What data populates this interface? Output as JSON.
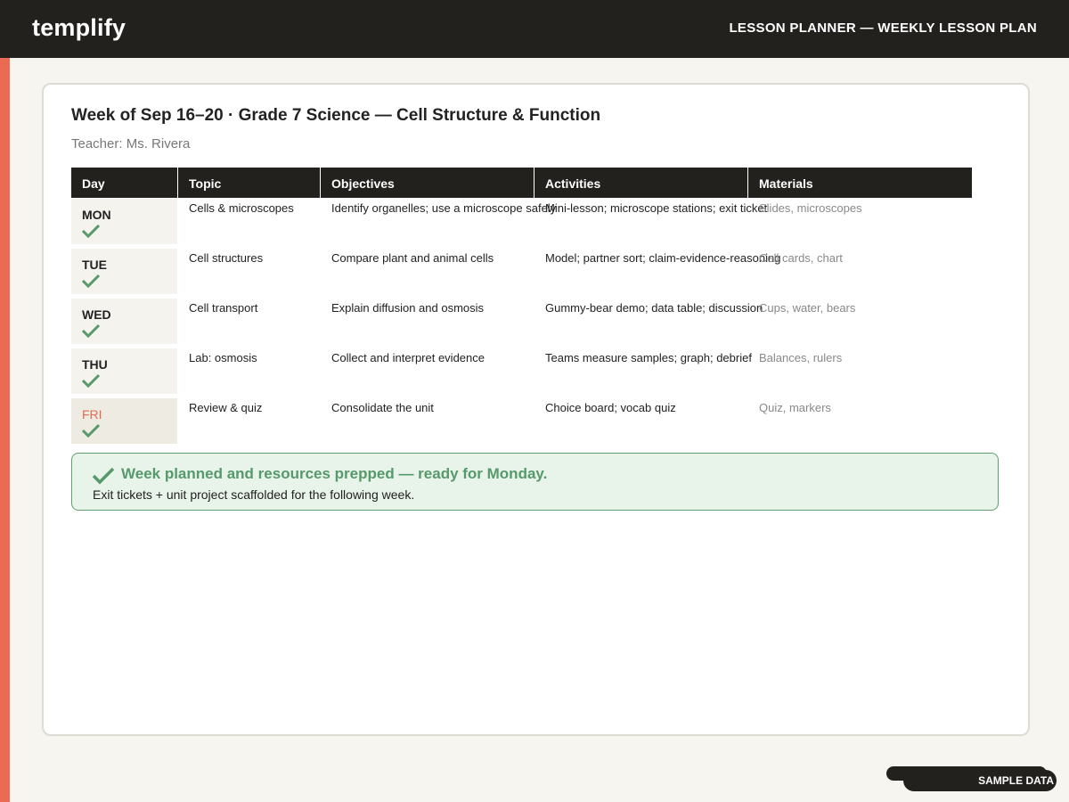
{
  "app": {
    "brand": "templify",
    "section_title": "LESSON PLANNER — WEEKLY LESSON PLAN"
  },
  "plan": {
    "title": "Week of Sep 16–20 · Grade 7 Science — Cell Structure & Function",
    "teacher": "Teacher: Ms. Rivera"
  },
  "table": {
    "headers": [
      "Day",
      "Topic",
      "Objectives",
      "Activities",
      "Materials"
    ],
    "rows": [
      {
        "day": "MON",
        "topic": "Cells & microscopes",
        "objectives": "Identify organelles; use a microscope safely",
        "activities": "Mini-lesson; microscope stations; exit ticket",
        "materials": "Slides, microscopes",
        "done": true,
        "current": false
      },
      {
        "day": "TUE",
        "topic": "Cell structures",
        "objectives": "Compare plant and animal cells",
        "activities": "Model; partner sort; claim-evidence-reasoning",
        "materials": "Cell cards, chart",
        "done": true,
        "current": false
      },
      {
        "day": "WED",
        "topic": "Cell transport",
        "objectives": "Explain diffusion and osmosis",
        "activities": "Gummy-bear demo; data table; discussion",
        "materials": "Cups, water, bears",
        "done": true,
        "current": false
      },
      {
        "day": "THU",
        "topic": "Lab: osmosis",
        "objectives": "Collect and interpret evidence",
        "activities": "Teams measure samples; graph; debrief",
        "materials": "Balances, rulers",
        "done": true,
        "current": false
      },
      {
        "day": "FRI",
        "topic": "Review & quiz",
        "objectives": "Consolidate the unit",
        "activities": "Choice board; vocab quiz",
        "materials": "Quiz, markers",
        "done": true,
        "current": true
      }
    ]
  },
  "banner": {
    "title": "Week planned and resources prepped — ready for Monday.",
    "subtitle": "Exit tickets + unit project scaffolded for the following week."
  },
  "badge": {
    "label": "SAMPLE DATA"
  },
  "colors": {
    "dark": "#23211e",
    "accent": "#ea6a52",
    "success": "#56996a",
    "success_bg": "#e8f3ea"
  },
  "icons": {
    "day_done": "check-icon",
    "banner": "check-icon"
  }
}
